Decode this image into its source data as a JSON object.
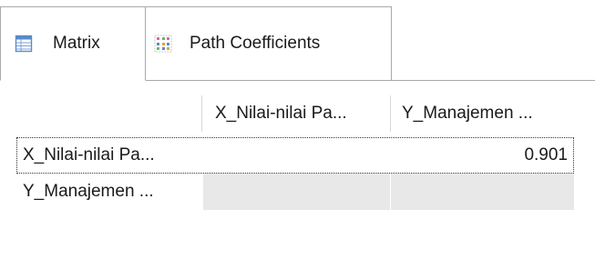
{
  "tabs": [
    {
      "label": "Matrix",
      "icon": "table-icon",
      "active": true
    },
    {
      "label": "Path Coefficients",
      "icon": "path-coefficients-icon",
      "active": false
    }
  ],
  "table": {
    "columns": [
      "",
      "X_Nilai-nilai Pa...",
      "Y_Manajemen ..."
    ],
    "rows": [
      {
        "label": "X_Nilai-nilai Pa...",
        "cells": [
          "",
          "0.901"
        ],
        "selected": true
      },
      {
        "label": "Y_Manajemen ...",
        "cells": [
          "",
          ""
        ],
        "selected": false
      }
    ]
  },
  "colors": {
    "tab_border": "#a9a9a9",
    "empty_cell_bg": "#e8e8e8",
    "icon_blue": "#5b8ac9"
  }
}
